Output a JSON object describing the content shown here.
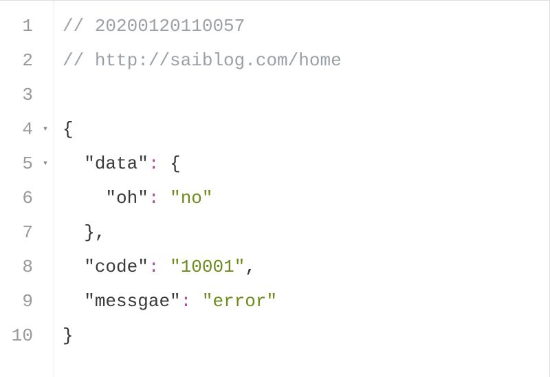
{
  "lines": {
    "n1": "1",
    "n2": "2",
    "n3": "3",
    "n4": "4",
    "n5": "5",
    "n6": "6",
    "n7": "7",
    "n8": "8",
    "n9": "9",
    "n10": "10"
  },
  "fold": {
    "l4": "▾",
    "l5": "▾"
  },
  "code": {
    "comment1_prefix": "// ",
    "comment1_text": "20200120110057",
    "comment2_prefix": "// ",
    "comment2_text": "http://saiblog.com/home",
    "brace_open": "{",
    "indent1": "  ",
    "indent2": "    ",
    "q": "\"",
    "key_data": "data",
    "key_oh": "oh",
    "key_code": "code",
    "key_messgae": "messgae",
    "val_no": "no",
    "val_10001": "10001",
    "val_error": "error",
    "colon_sp": ": ",
    "brace_open2": "{",
    "brace_close_comma": "},",
    "comma": ",",
    "brace_close": "}"
  }
}
